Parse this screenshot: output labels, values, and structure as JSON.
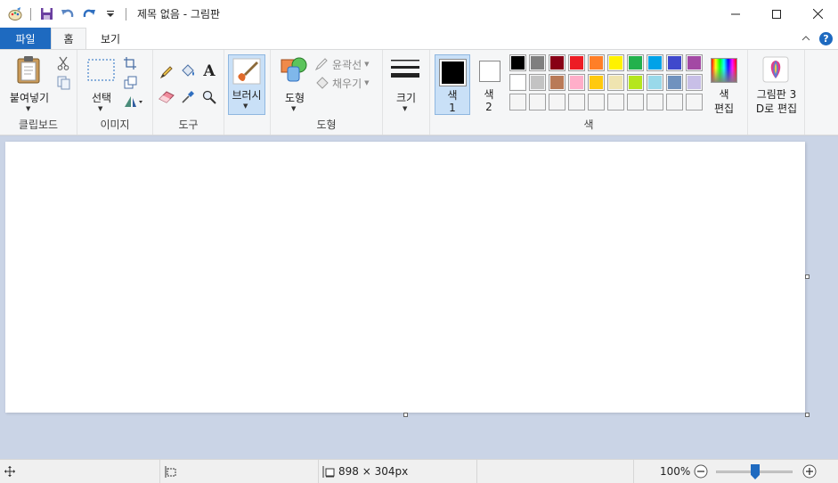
{
  "window": {
    "title": "제목 없음 - 그림판",
    "title_separator": "|"
  },
  "tabs": {
    "file": "파일",
    "home": "홈",
    "view": "보기"
  },
  "ribbon": {
    "clipboard": {
      "group_label": "클립보드",
      "paste_label": "붙여넣기"
    },
    "image": {
      "group_label": "이미지",
      "select_label": "선택"
    },
    "tools": {
      "group_label": "도구",
      "text_tool": "A"
    },
    "brushes": {
      "label": "브러시"
    },
    "shapes": {
      "group_label": "도형",
      "shapes_label": "도형",
      "outline_label": "윤곽선",
      "fill_label": "채우기"
    },
    "size": {
      "label": "크기"
    },
    "colors": {
      "group_label": "색",
      "color1_line1": "색",
      "color1_line2": "1",
      "color2_line1": "색",
      "color2_line2": "2",
      "edit_line1": "색",
      "edit_line2": "편집",
      "color1_value": "#000000",
      "color2_value": "#ffffff",
      "palette_row1": [
        "#000000",
        "#7f7f7f",
        "#880015",
        "#ed1c24",
        "#ff7f27",
        "#fff200",
        "#22b14c",
        "#00a2e8",
        "#3f48cc",
        "#a349a4"
      ],
      "palette_row2": [
        "#ffffff",
        "#c3c3c3",
        "#b97a57",
        "#ffaec9",
        "#ffc90e",
        "#efe4b0",
        "#b5e61d",
        "#99d9ea",
        "#7092be",
        "#c8bfe7"
      ],
      "palette_row3": [
        "#f5f5f5",
        "#f5f5f5",
        "#f5f5f5",
        "#f5f5f5",
        "#f5f5f5",
        "#f5f5f5",
        "#f5f5f5",
        "#f5f5f5",
        "#f5f5f5",
        "#f5f5f5"
      ]
    },
    "paint3d": {
      "line1": "그림판 3",
      "line2": "D로 편집"
    }
  },
  "statusbar": {
    "image_size": "898 × 304px",
    "zoom_level": "100%"
  },
  "colors": {
    "accent": "#1e6ac0",
    "ribbon_bg": "#f5f6f7",
    "workspace_bg": "#cad4e6"
  }
}
